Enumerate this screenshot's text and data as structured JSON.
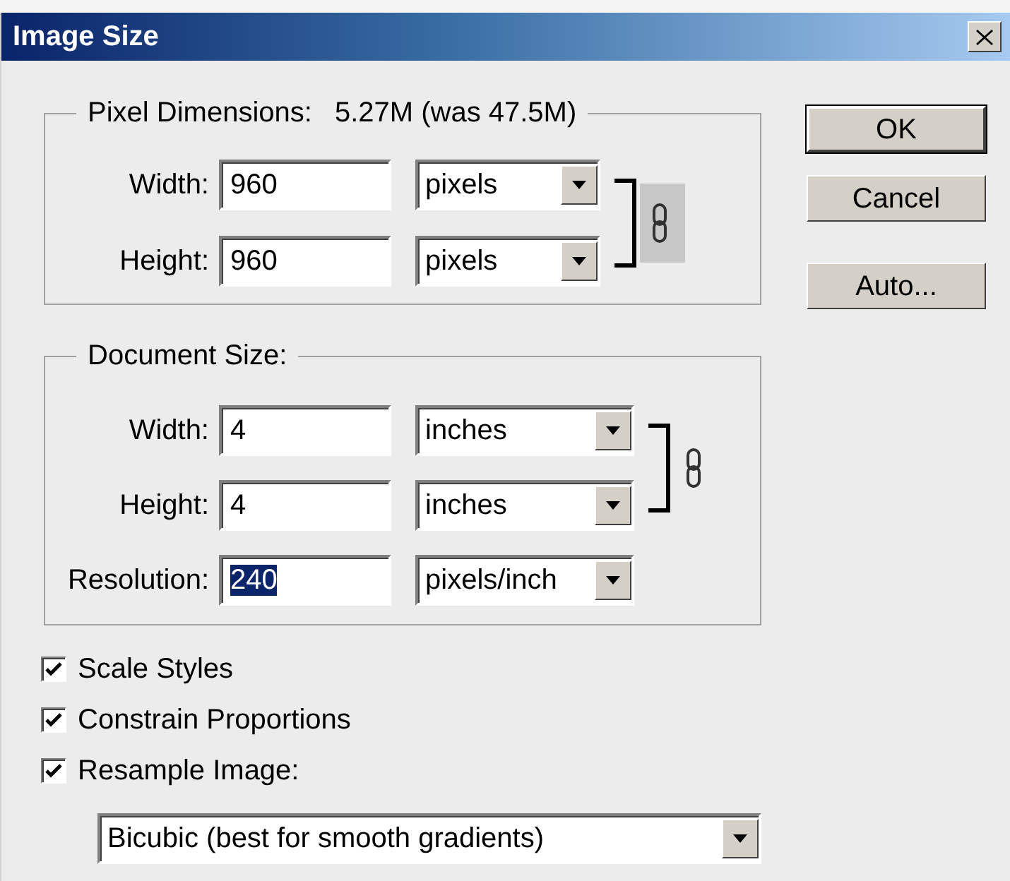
{
  "window": {
    "title": "Image Size"
  },
  "pixel_dimensions": {
    "label": "Pixel Dimensions:",
    "value": "5.27M (was 47.5M)",
    "link_shaded": true,
    "rows": [
      {
        "kind": "dimension",
        "label": "Width:",
        "value": "960",
        "unit": "pixels",
        "selected": false
      },
      {
        "kind": "dimension",
        "label": "Height:",
        "value": "960",
        "unit": "pixels",
        "selected": false
      }
    ]
  },
  "document_size": {
    "label": "Document Size:",
    "link_shaded": false,
    "rows": [
      {
        "kind": "dimension",
        "label": "Width:",
        "value": "4",
        "unit": "inches",
        "selected": false
      },
      {
        "kind": "dimension",
        "label": "Height:",
        "value": "4",
        "unit": "inches",
        "selected": false
      },
      {
        "kind": "resolution",
        "label": "Resolution:",
        "value": "240",
        "unit": "pixels/inch",
        "selected": true
      }
    ]
  },
  "options": [
    {
      "label": "Scale Styles",
      "checked": true
    },
    {
      "label": "Constrain Proportions",
      "checked": true
    },
    {
      "label": "Resample Image:",
      "checked": true
    }
  ],
  "resample_method": "Bicubic (best for smooth gradients)",
  "buttons": [
    {
      "label": "OK",
      "default": true
    },
    {
      "label": "Cancel",
      "default": false
    },
    {
      "label": "Auto...",
      "default": false
    }
  ]
}
